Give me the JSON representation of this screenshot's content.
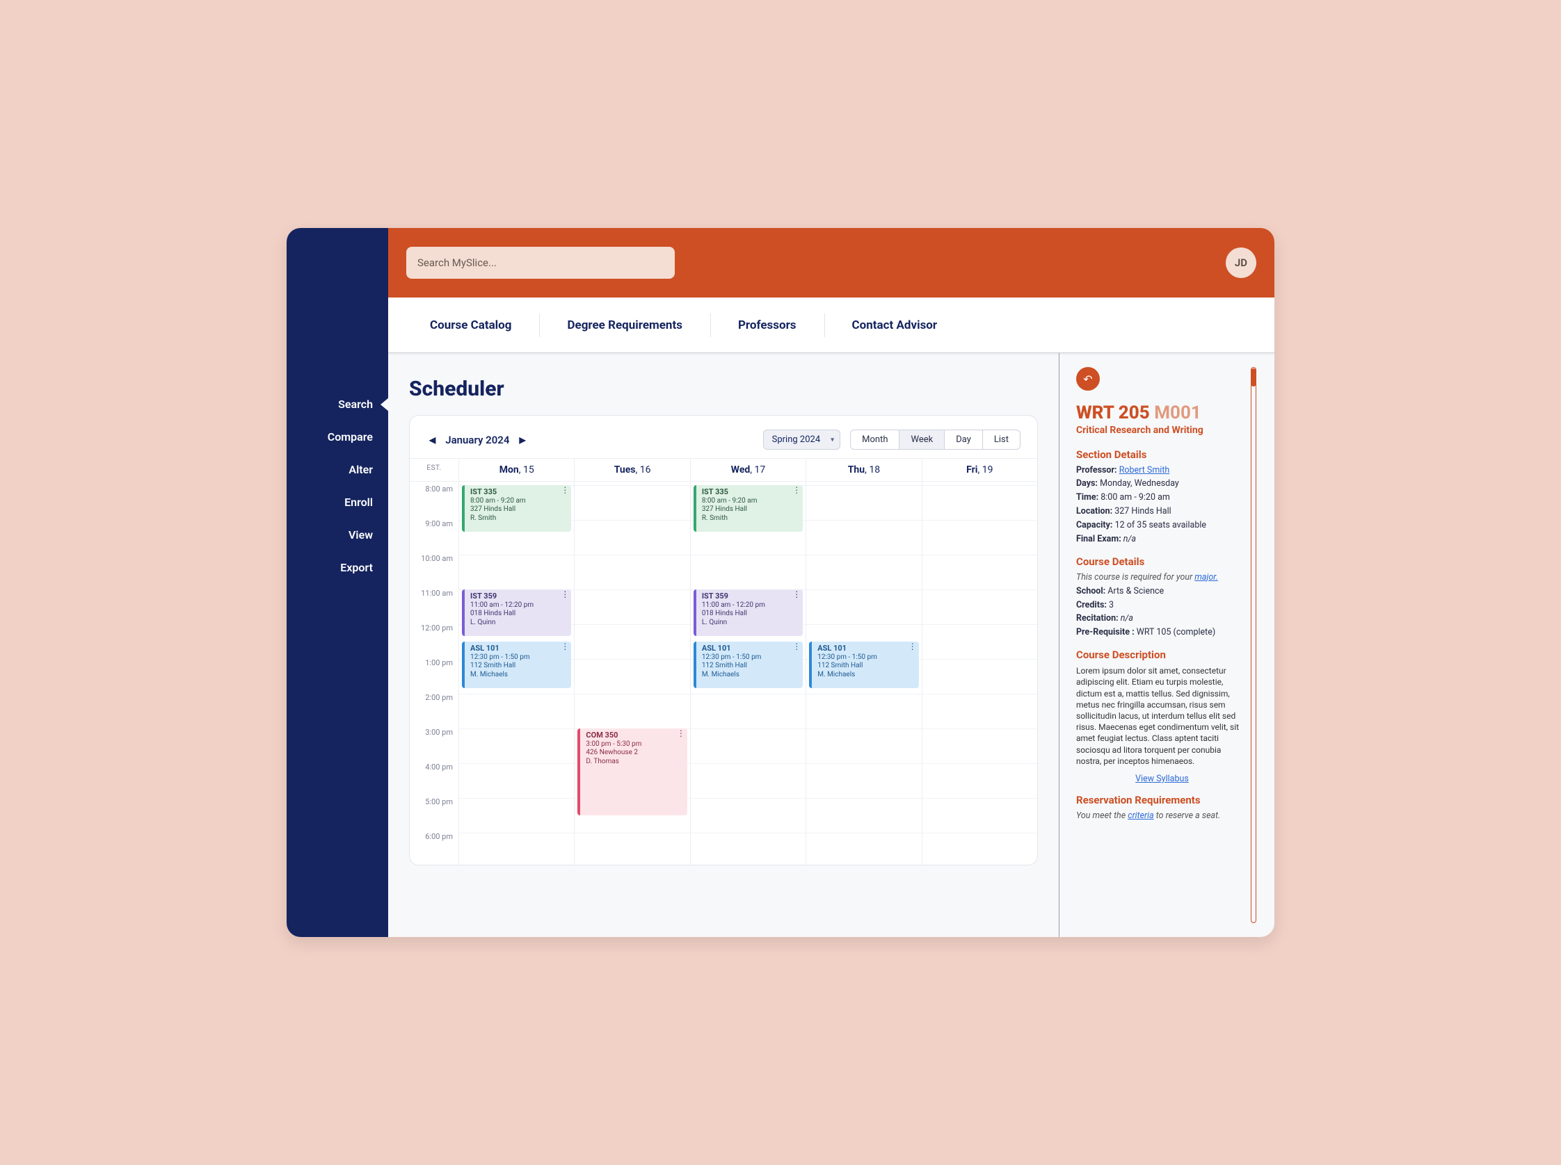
{
  "header": {
    "search_placeholder": "Search MySlice...",
    "avatar_initials": "JD"
  },
  "tabs": {
    "catalog": "Course Catalog",
    "degree": "Degree Requirements",
    "professors": "Professors",
    "advisor": "Contact Advisor"
  },
  "sidebar": {
    "search": "Search",
    "compare": "Compare",
    "alter": "Alter",
    "enroll": "Enroll",
    "view": "View",
    "export": "Export"
  },
  "page": {
    "title": "Scheduler"
  },
  "calendar": {
    "month_label": "January 2024",
    "term": "Spring 2024",
    "views": {
      "month": "Month",
      "week": "Week",
      "day": "Day",
      "list": "List"
    },
    "est_label": "EST.",
    "days": {
      "mon": {
        "name": "Mon",
        "num": "15"
      },
      "tue": {
        "name": "Tues",
        "num": "16"
      },
      "wed": {
        "name": "Wed",
        "num": "17"
      },
      "thu": {
        "name": "Thu",
        "num": "18"
      },
      "fri": {
        "name": "Fri",
        "num": "19"
      }
    },
    "hours": {
      "h8": "8:00 am",
      "h9": "9:00 am",
      "h10": "10:00 am",
      "h11": "11:00 am",
      "h12": "12:00 pm",
      "h13": "1:00 pm",
      "h14": "2:00 pm",
      "h15": "3:00 pm",
      "h16": "4:00 pm",
      "h17": "5:00 pm",
      "h18": "6:00 pm"
    }
  },
  "events": {
    "ist335_mon": {
      "title": "IST 335",
      "time": "8:00 am - 9:20 am",
      "loc": "327 Hinds Hall",
      "prof": "R. Smith"
    },
    "ist335_wed": {
      "title": "IST 335",
      "time": "8:00 am - 9:20 am",
      "loc": "327 Hinds Hall",
      "prof": "R. Smith"
    },
    "ist359_mon": {
      "title": "IST 359",
      "time": "11:00 am - 12:20 pm",
      "loc": "018 Hinds Hall",
      "prof": "L. Quinn"
    },
    "ist359_wed": {
      "title": "IST 359",
      "time": "11:00 am - 12:20 pm",
      "loc": "018 Hinds Hall",
      "prof": "L. Quinn"
    },
    "asl101_mon": {
      "title": "ASL 101",
      "time": "12:30 pm - 1:50 pm",
      "loc": "112 Smith Hall",
      "prof": "M. Michaels"
    },
    "asl101_wed": {
      "title": "ASL 101",
      "time": "12:30 pm - 1:50 pm",
      "loc": "112 Smith Hall",
      "prof": "M. Michaels"
    },
    "asl101_thu": {
      "title": "ASL 101",
      "time": "12:30 pm - 1:50 pm",
      "loc": "112 Smith Hall",
      "prof": "M. Michaels"
    },
    "com350_tue": {
      "title": "COM 350",
      "time": "3:00 pm - 5:30 pm",
      "loc": "426 Newhouse 2",
      "prof": "D. Thomas"
    }
  },
  "detail": {
    "code": "WRT 205",
    "section": "M001",
    "name": "Critical Research and Writing",
    "section_heading": "Section Details",
    "labels": {
      "professor": "Professor:",
      "days": "Days:",
      "time": "Time:",
      "location": "Location:",
      "capacity": "Capacity:",
      "final": "Final Exam:",
      "school": "School:",
      "credits": "Credits:",
      "recitation": "Recitation:",
      "prereq": "Pre-Requisite :"
    },
    "professor_name": "Robert Smith",
    "days": " Monday, Wednesday",
    "time": " 8:00 am - 9:20 am",
    "location": " 327 Hinds Hall",
    "capacity": " 12 of 35 seats available",
    "final": " n/a",
    "course_heading": "Course Details",
    "required_prefix": "This course is required for your ",
    "required_link": "major.",
    "school": " Arts & Science",
    "credits": " 3",
    "recitation": " n/a",
    "prereq": " WRT 105 (complete)",
    "desc_heading": "Course Description",
    "description": "Lorem ipsum dolor sit amet, consectetur adipiscing elit. Etiam eu turpis molestie, dictum est a, mattis tellus. Sed dignissim, metus nec fringilla accumsan, risus sem sollicitudin lacus, ut interdum tellus elit sed risus. Maecenas eget condimentum velit, sit amet feugiat lectus. Class aptent taciti sociosqu ad litora torquent per conubia nostra, per inceptos himenaeos.",
    "syllabus_link": "View Syllabus",
    "res_heading": "Reservation Requirements",
    "res_prefix": "You meet the ",
    "res_link": "criteria",
    "res_suffix": " to reserve a seat."
  }
}
